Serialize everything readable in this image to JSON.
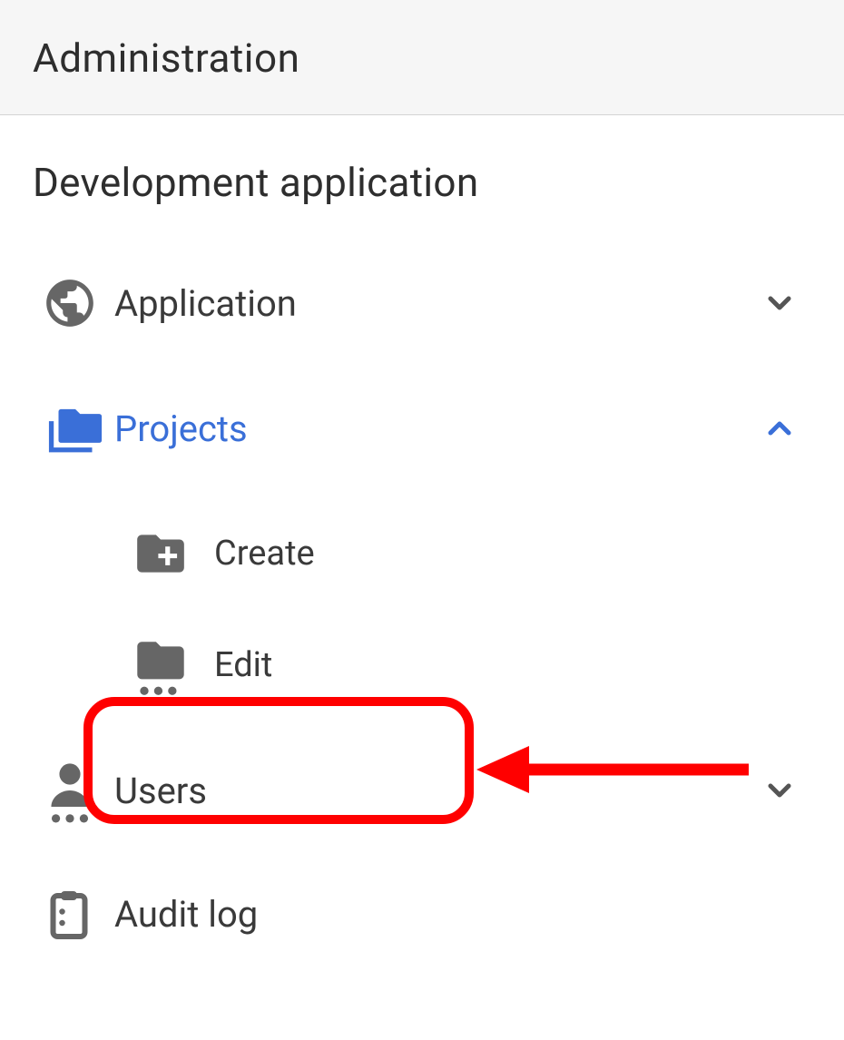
{
  "header": {
    "title": "Administration"
  },
  "section": {
    "title": "Development application"
  },
  "nav": {
    "items": [
      {
        "icon": "globe",
        "label": "Application",
        "expanded": false,
        "active": false
      },
      {
        "icon": "folders",
        "label": "Projects",
        "expanded": true,
        "active": true,
        "children": [
          {
            "icon": "folder-plus",
            "label": "Create"
          },
          {
            "icon": "folder-dots",
            "label": "Edit"
          }
        ]
      },
      {
        "icon": "user-dots",
        "label": "Users",
        "expanded": false,
        "active": false
      },
      {
        "icon": "clipboard",
        "label": "Audit log",
        "expanded": false,
        "active": false
      }
    ]
  },
  "annotation": {
    "highlighted_item": "Edit"
  },
  "colors": {
    "accent": "#3a6fd8",
    "icon_gray": "#666666",
    "text": "#3a3a3a",
    "annotation_red": "#ff0000"
  }
}
